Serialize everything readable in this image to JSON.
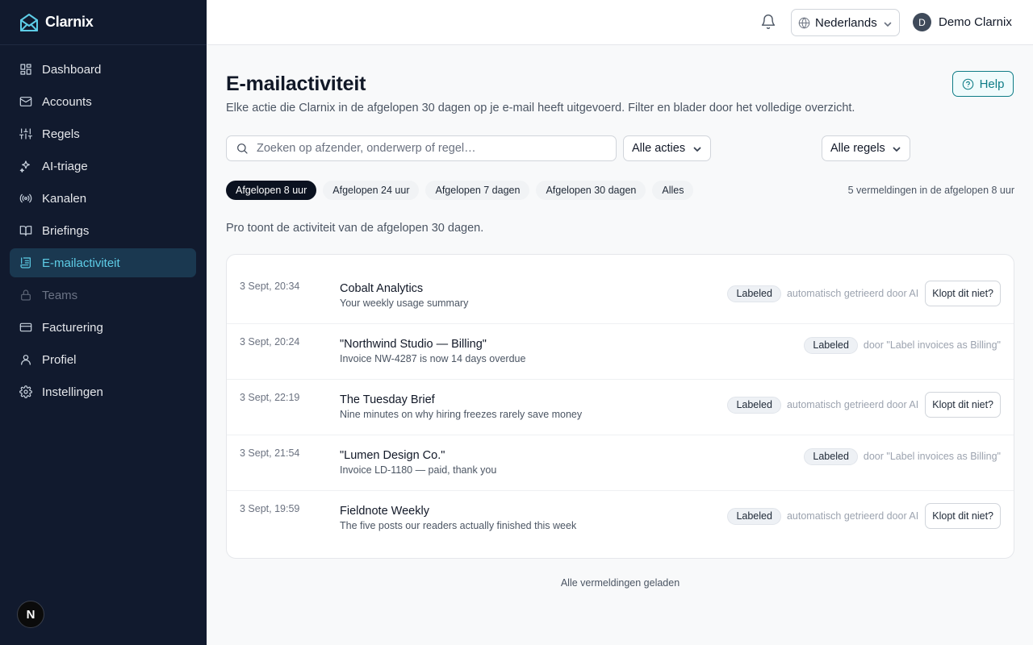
{
  "brand": {
    "name": "Clarnix"
  },
  "sidebar": {
    "items": [
      {
        "label": "Dashboard",
        "icon": "dashboard-icon",
        "state": "normal"
      },
      {
        "label": "Accounts",
        "icon": "mail-icon",
        "state": "normal"
      },
      {
        "label": "Regels",
        "icon": "sliders-icon",
        "state": "normal"
      },
      {
        "label": "AI-triage",
        "icon": "sparkles-icon",
        "state": "normal"
      },
      {
        "label": "Kanalen",
        "icon": "broadcast-icon",
        "state": "normal"
      },
      {
        "label": "Briefings",
        "icon": "book-icon",
        "state": "normal"
      },
      {
        "label": "E-mailactiviteit",
        "icon": "activity-list-icon",
        "state": "active"
      },
      {
        "label": "Teams",
        "icon": "lock-icon",
        "state": "disabled"
      },
      {
        "label": "Facturering",
        "icon": "credit-card-icon",
        "state": "normal"
      },
      {
        "label": "Profiel",
        "icon": "user-icon",
        "state": "normal"
      },
      {
        "label": "Instellingen",
        "icon": "gear-icon",
        "state": "normal"
      }
    ],
    "footer_badge": "N"
  },
  "topbar": {
    "language": "Nederlands",
    "user_initial": "D",
    "user_name": "Demo Clarnix"
  },
  "page": {
    "title": "E-mailactiviteit",
    "subtitle": "Elke actie die Clarnix in de afgelopen 30 dagen op je e-mail heeft uitgevoerd. Filter en blader door het volledige overzicht.",
    "help_label": "Help"
  },
  "filters": {
    "search_placeholder": "Zoeken op afzender, onderwerp of regel…",
    "actions_select": "Alle acties",
    "rules_select": "Alle regels",
    "time_chips": [
      "Afgelopen 8 uur",
      "Afgelopen 24 uur",
      "Afgelopen 7 dagen",
      "Afgelopen 30 dagen",
      "Alles"
    ],
    "active_chip_index": 0,
    "count_note": "5 vermeldingen in de afgelopen 8 uur"
  },
  "pro_note": "Pro toont de activiteit van de afgelopen 30 dagen.",
  "entries": [
    {
      "time": "3 Sept, 20:34",
      "sender": "Cobalt Analytics",
      "subject": "Your weekly usage summary",
      "tag": "Labeled",
      "note": "automatisch getrieerd door AI",
      "feedback": "Klopt dit niet?"
    },
    {
      "time": "3 Sept, 20:24",
      "sender": "\"Northwind Studio — Billing\"",
      "subject": "Invoice NW-4287 is now 14 days overdue",
      "tag": "Labeled",
      "note": "door \"Label invoices as Billing\"",
      "feedback": ""
    },
    {
      "time": "3 Sept, 22:19",
      "sender": "The Tuesday Brief",
      "subject": "Nine minutes on why hiring freezes rarely save money",
      "tag": "Labeled",
      "note": "automatisch getrieerd door AI",
      "feedback": "Klopt dit niet?"
    },
    {
      "time": "3 Sept, 21:54",
      "sender": "\"Lumen Design Co.\"",
      "subject": "Invoice LD-1180 — paid, thank you",
      "tag": "Labeled",
      "note": "door \"Label invoices as Billing\"",
      "feedback": ""
    },
    {
      "time": "3 Sept, 19:59",
      "sender": "Fieldnote Weekly",
      "subject": "The five posts our readers actually finished this week",
      "tag": "Labeled",
      "note": "automatisch getrieerd door AI",
      "feedback": "Klopt dit niet?"
    }
  ],
  "footer_note": "Alle vermeldingen geladen",
  "colors": {
    "sidebar_bg": "#111a2e",
    "accent": "#0e7c86",
    "active_text": "#5ecde7"
  }
}
